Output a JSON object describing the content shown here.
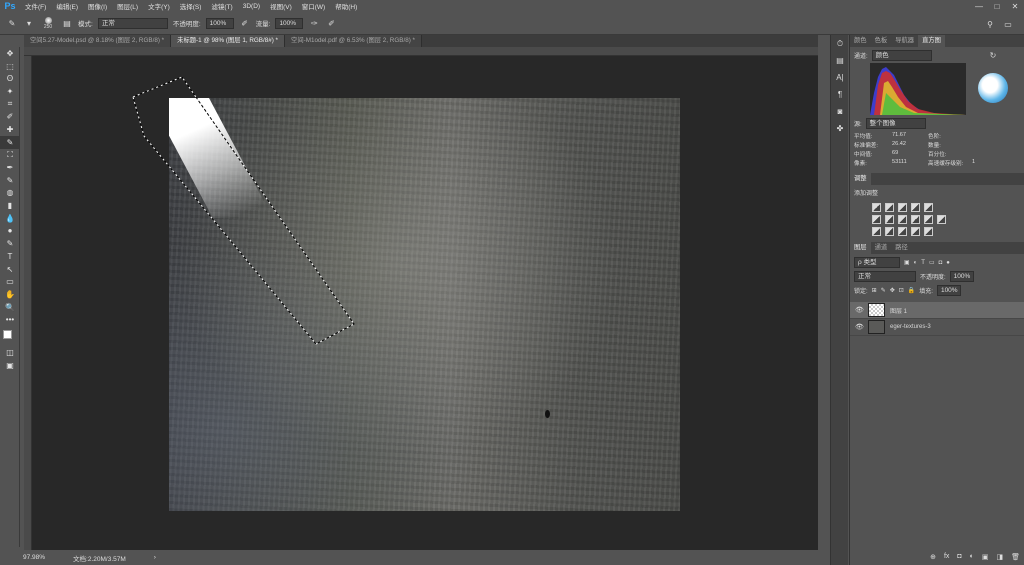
{
  "menubar": {
    "logo": "Ps",
    "items": [
      "文件(F)",
      "编辑(E)",
      "图像(I)",
      "图层(L)",
      "文字(Y)",
      "选择(S)",
      "滤镜(T)",
      "3D(D)",
      "视图(V)",
      "窗口(W)",
      "帮助(H)"
    ],
    "win": [
      "—",
      "□",
      "✕"
    ]
  },
  "options": {
    "brush_size": "250",
    "mode_label": "模式:",
    "mode_value": "正常",
    "opacity_label": "不透明度:",
    "opacity_value": "100%",
    "flow_label": "流量:",
    "flow_value": "100%"
  },
  "tabs": [
    {
      "label": "空间5.27-Model.psd @ 8.18% (图层 2, RGB/8) *"
    },
    {
      "label": "未标题-1 @ 98% (图层 1, RGB/8#) *"
    },
    {
      "label": "空间-M1odel.pdf @ 6.53% (图层 2, RGB/8) *"
    }
  ],
  "tools": [
    "✥",
    "⬚",
    "ʘ",
    "✦",
    "⌗",
    "✐",
    "✚",
    "✎",
    "⛶",
    "✒",
    "✎",
    "◍",
    "▮",
    "💧",
    "●",
    "✎",
    "T",
    "↖",
    "▭",
    "✋",
    "🔍",
    "•••"
  ],
  "status": {
    "zoom": "97.98%",
    "doc": "文档:2.20M/3.57M"
  },
  "histogram_panel": {
    "tabs": [
      "颜色",
      "色板",
      "导航器",
      "直方图"
    ],
    "channel_label": "通道:",
    "channel_value": "颜色",
    "source_label": "源:",
    "source_value": "整个图像",
    "stats": [
      [
        "平均值:",
        "71.67",
        "色阶:",
        ""
      ],
      [
        "标准偏差:",
        "26.42",
        "数量:",
        ""
      ],
      [
        "中间值:",
        "69",
        "百分位:",
        ""
      ],
      [
        "像素:",
        "53111",
        "高速缓存级别:",
        "1"
      ]
    ]
  },
  "adjustments_panel": {
    "tab": "调整",
    "add_label": "添加调整"
  },
  "layers_panel": {
    "tabs": [
      "图层",
      "通道",
      "路径"
    ],
    "kind_label": "ρ 类型",
    "blend_mode": "正常",
    "opacity_label": "不透明度:",
    "opacity_value": "100%",
    "lock_label": "锁定:",
    "fill_label": "填充:",
    "fill_value": "100%",
    "layers": [
      {
        "name": "图层 1",
        "selected": true
      },
      {
        "name": "eger-textures-3",
        "selected": false
      }
    ],
    "bottom_icons": [
      "⊕",
      "fx",
      "◘",
      "◐",
      "▣",
      "◨",
      "🗑"
    ]
  },
  "colors": {
    "app_bg": "#535353",
    "workspace": "#282828",
    "accent": "#31a8ff",
    "selected_layer": "#696969"
  }
}
